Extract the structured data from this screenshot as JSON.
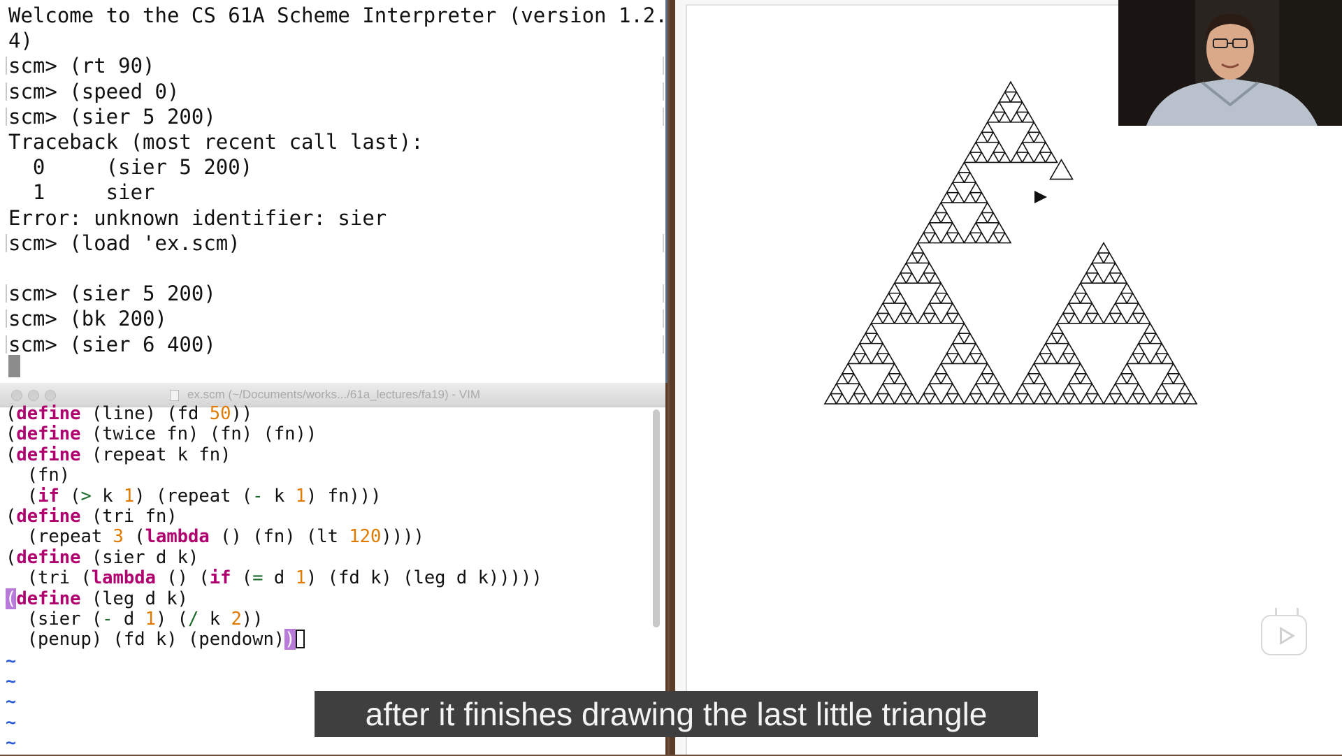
{
  "terminal": {
    "lines": [
      "Welcome to the CS 61A Scheme Interpreter (version 1.2.",
      "4)",
      "scm> (rt 90)",
      "scm> (speed 0)",
      "scm> (sier 5 200)",
      "Traceback (most recent call last):",
      "  0     (sier 5 200)",
      "  1     sier",
      "Error: unknown identifier: sier",
      "scm> (load 'ex.scm)",
      "",
      "scm> (sier 5 200)",
      "scm> (bk 200)",
      "scm> (sier 6 400)"
    ]
  },
  "vim": {
    "title": "ex.scm (~/Documents/works.../61a_lectures/fa19) - VIM",
    "code": [
      [
        {
          "t": "("
        },
        {
          "t": "define",
          "c": "kw"
        },
        {
          "t": " (line) (fd "
        },
        {
          "t": "50",
          "c": "num"
        },
        {
          "t": "))"
        }
      ],
      [
        {
          "t": "("
        },
        {
          "t": "define",
          "c": "kw"
        },
        {
          "t": " (twice fn) (fn) (fn))"
        }
      ],
      [
        {
          "t": "("
        },
        {
          "t": "define",
          "c": "kw"
        },
        {
          "t": " (repeat k fn)"
        }
      ],
      [
        {
          "t": "  (fn)"
        }
      ],
      [
        {
          "t": "  ("
        },
        {
          "t": "if",
          "c": "kw"
        },
        {
          "t": " ("
        },
        {
          "t": ">",
          "c": "op"
        },
        {
          "t": " k "
        },
        {
          "t": "1",
          "c": "num"
        },
        {
          "t": ") (repeat ("
        },
        {
          "t": "-",
          "c": "op"
        },
        {
          "t": " k "
        },
        {
          "t": "1",
          "c": "num"
        },
        {
          "t": ") fn)))"
        }
      ],
      [
        {
          "t": "("
        },
        {
          "t": "define",
          "c": "kw"
        },
        {
          "t": " (tri fn)"
        }
      ],
      [
        {
          "t": "  (repeat "
        },
        {
          "t": "3",
          "c": "num"
        },
        {
          "t": " ("
        },
        {
          "t": "lambda",
          "c": "kw"
        },
        {
          "t": " () (fn) (lt "
        },
        {
          "t": "120",
          "c": "num"
        },
        {
          "t": "))))"
        }
      ],
      [
        {
          "t": "("
        },
        {
          "t": "define",
          "c": "kw"
        },
        {
          "t": " (sier d k)"
        }
      ],
      [
        {
          "t": "  (tri ("
        },
        {
          "t": "lambda",
          "c": "kw"
        },
        {
          "t": " () ("
        },
        {
          "t": "if",
          "c": "kw"
        },
        {
          "t": " ("
        },
        {
          "t": "=",
          "c": "op"
        },
        {
          "t": " d "
        },
        {
          "t": "1",
          "c": "num"
        },
        {
          "t": ") (fd k) (leg d k)))))"
        }
      ],
      [
        {
          "t": "(",
          "c": "hl"
        },
        {
          "t": "define",
          "c": "kw"
        },
        {
          "t": " (leg d k)"
        }
      ],
      [
        {
          "t": "  (sier ("
        },
        {
          "t": "-",
          "c": "op"
        },
        {
          "t": " d "
        },
        {
          "t": "1",
          "c": "num"
        },
        {
          "t": ") ("
        },
        {
          "t": "/",
          "c": "op"
        },
        {
          "t": " k "
        },
        {
          "t": "2",
          "c": "num"
        },
        {
          "t": "))"
        }
      ],
      [
        {
          "t": "  (penup) (fd k) (pendown)"
        },
        {
          "t": ")",
          "c": "hl"
        },
        {
          "t": "",
          "c": "cur"
        }
      ]
    ],
    "tildes": [
      "~",
      "~",
      "~",
      "~",
      "~"
    ]
  },
  "subtitle": "after it finishes drawing the last little triangle",
  "colors": {
    "keyword": "#b0006e",
    "number": "#e07b00",
    "operator": "#1a6a2a",
    "bracket_highlight": "#b97bd9",
    "tilde": "#2b5bd6"
  },
  "icons": {
    "play": "play-icon",
    "turtle_cursor": "turtle-arrow-icon"
  }
}
